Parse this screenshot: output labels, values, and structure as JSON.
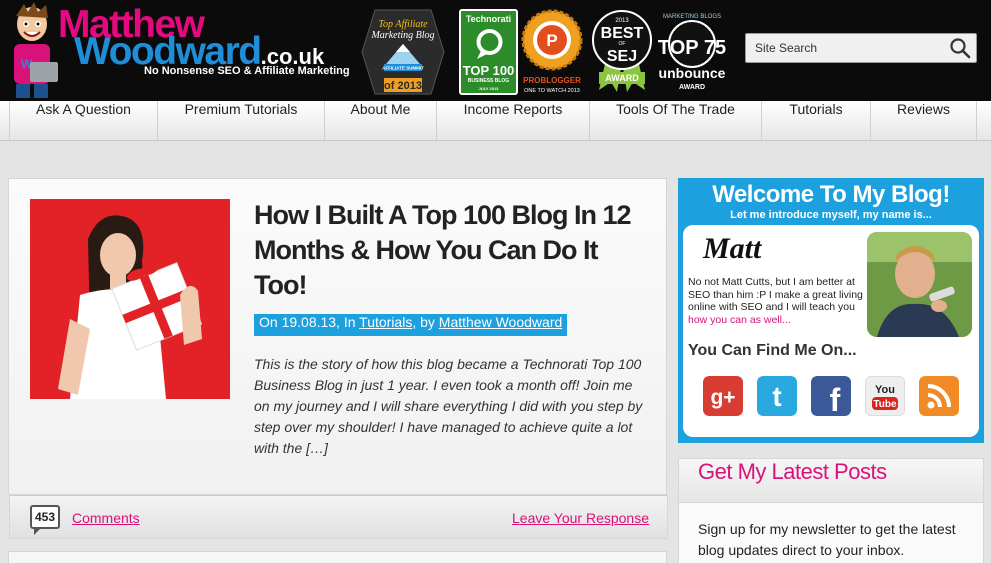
{
  "header": {
    "logo_line1": "Matthew",
    "logo_line2_name": "Woodward",
    "logo_line2_tld": ".co.uk",
    "tagline": "No Nonsense SEO & Affiliate Marketing",
    "badges": {
      "affiliate": {
        "line1": "Top Affiliate",
        "line2": "Marketing Blog",
        "line3": "AFFILIATE SUMMIT",
        "year": "of 2013"
      },
      "technorati": {
        "brand": "Technorati",
        "main": "TOP 100",
        "sub": "BUSINESS BLOG",
        "date": "JULY 2013"
      },
      "problogger": {
        "brand": "PROBLOGGER",
        "sub": "ONE TO WATCH 2013"
      },
      "sej": {
        "year": "2013",
        "best": "BEST",
        "of": "OF",
        "sej": "SEJ",
        "award": "AWARD"
      },
      "unbounce": {
        "top": "MARKETING BLOGS",
        "big": "TOP 75",
        "brand": "unbounce",
        "award": "AWARD"
      }
    }
  },
  "search": {
    "placeholder": "Site Search"
  },
  "nav": {
    "items": [
      {
        "label": "Ask A Question"
      },
      {
        "label": "Premium Tutorials"
      },
      {
        "label": "About Me"
      },
      {
        "label": "Income Reports"
      },
      {
        "label": "Tools Of The Trade"
      },
      {
        "label": "Tutorials"
      },
      {
        "label": "Reviews"
      }
    ]
  },
  "post": {
    "title": "How I Built A Top 100 Blog In 12 Months & How You Can Do It Too!",
    "meta_prefix": "On 19.08.13, In ",
    "category": "Tutorials",
    "meta_by": ", by ",
    "author": "Matthew Woodward",
    "excerpt": "This is the story of how this blog became a Technorati Top 100 Business Blog in just 1 year. I even took a month off! Join me on my journey and I will share everything I did with you step by step over my shoulder! I have managed to achieve quite a lot with the […]",
    "comment_count": "453",
    "comments_label": "Comments",
    "respond_label": "Leave Your Response"
  },
  "welcome": {
    "title": "Welcome To My Blog!",
    "subtitle": "Let me introduce myself, my name is...",
    "name": "Matt",
    "bio": "No not Matt Cutts, but I am better at SEO than him :P I make a great living online with SEO and I will teach you ",
    "bio_link": "how you can as well...",
    "find_me": "You Can Find Me On...",
    "social": {
      "google": "g+",
      "twitter": "t",
      "facebook": "f",
      "youtube_you": "You",
      "youtube_tube": "Tube"
    }
  },
  "latest": {
    "title": "Get My Latest Posts",
    "text": "Sign up for my newsletter to get the latest blog updates direct to your inbox."
  },
  "colors": {
    "brand_pink": "#d9127b",
    "brand_blue": "#1ca0de",
    "header_bg": "#0b0b0b"
  }
}
